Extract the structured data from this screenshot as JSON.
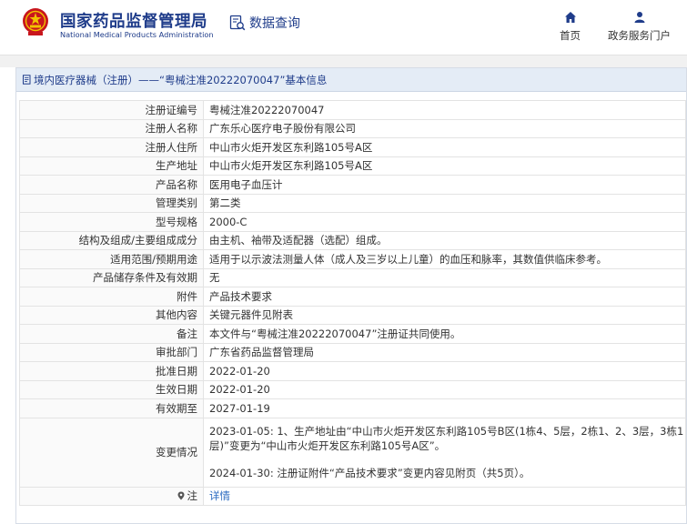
{
  "header": {
    "brand_cn": "国家药品监督管理局",
    "brand_en": "National Medical Products Administration",
    "query_label": "数据查询",
    "nav": [
      {
        "label": "首页",
        "icon": "home-icon"
      },
      {
        "label": "政务服务门户",
        "icon": "user-icon"
      }
    ],
    "brand_color": "#1f3c8a",
    "emblem_color": "#c8161d"
  },
  "panel": {
    "title": "境内医疗器械（注册）——“粤械注准20222070047”基本信息",
    "rows": [
      {
        "label": "注册证编号",
        "value": "粤械注准20222070047"
      },
      {
        "label": "注册人名称",
        "value": "广东乐心医疗电子股份有限公司"
      },
      {
        "label": "注册人住所",
        "value": "中山市火炬开发区东利路105号A区"
      },
      {
        "label": "生产地址",
        "value": "中山市火炬开发区东利路105号A区"
      },
      {
        "label": "产品名称",
        "value": "医用电子血压计"
      },
      {
        "label": "管理类别",
        "value": "第二类"
      },
      {
        "label": "型号规格",
        "value": "2000-C"
      },
      {
        "label": "结构及组成/主要组成成分",
        "value": "由主机、袖带及适配器（选配）组成。"
      },
      {
        "label": "适用范围/预期用途",
        "value": "适用于以示波法测量人体（成人及三岁以上儿童）的血压和脉率，其数值供临床参考。"
      },
      {
        "label": "产品储存条件及有效期",
        "value": "无"
      },
      {
        "label": "附件",
        "value": "产品技术要求"
      },
      {
        "label": "其他内容",
        "value": "关键元器件见附表"
      },
      {
        "label": "备注",
        "value": "本文件与“粤械注准20222070047”注册证共同使用。"
      },
      {
        "label": "审批部门",
        "value": "广东省药品监督管理局"
      },
      {
        "label": "批准日期",
        "value": "2022-01-20"
      },
      {
        "label": "生效日期",
        "value": "2022-01-20"
      },
      {
        "label": "有效期至",
        "value": "2027-01-19"
      }
    ],
    "change": {
      "label": "变更情况",
      "entries": [
        "2023-01-05: 1、生产地址由“中山市火炬开发区东利路105号B区(1栋4、5层，2栋1、2、3层，3栋1层)”变更为“中山市火炬开发区东利路105号A区”。",
        "2024-01-30: 注册证附件“产品技术要求”变更内容见附页（共5页）。"
      ]
    },
    "note": {
      "label": "注",
      "link_text": "详情"
    }
  }
}
